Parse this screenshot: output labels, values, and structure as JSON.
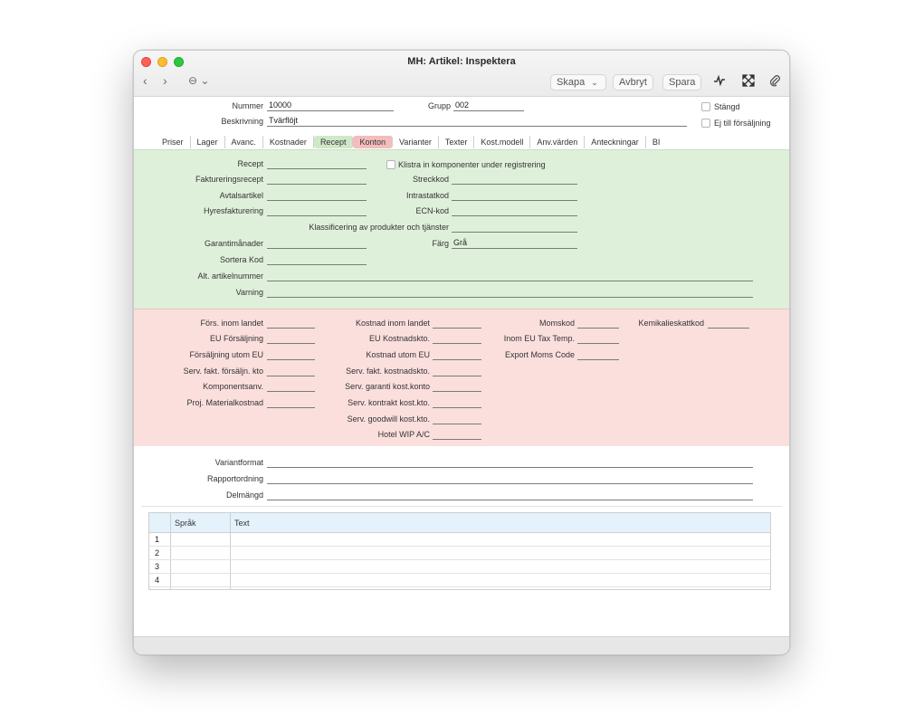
{
  "window": {
    "title": "MH: Artikel: Inspektera",
    "nav_back": "‹",
    "nav_forward": "›",
    "more_label": "⊖ ⌄"
  },
  "toolbar": {
    "create_label": "Skapa",
    "cancel_label": "Avbryt",
    "save_label": "Spara"
  },
  "header": {
    "number_label": "Nummer",
    "number_value": "10000",
    "group_label": "Grupp",
    "group_value": "002",
    "description_label": "Beskrivning",
    "description_value": "Tvärflöjt",
    "closed_label": "Stängd",
    "not_for_sale_label": "Ej till försäljning"
  },
  "tabs": [
    {
      "label": "Priser"
    },
    {
      "label": "Lager"
    },
    {
      "label": "Avanc."
    },
    {
      "label": "Kostnader"
    },
    {
      "label": "Recept"
    },
    {
      "label": "Konton"
    },
    {
      "label": "Varianter"
    },
    {
      "label": "Texter"
    },
    {
      "label": "Kost.modell"
    },
    {
      "label": "Anv.värden"
    },
    {
      "label": "Anteckningar"
    },
    {
      "label": "BI"
    }
  ],
  "recipe": {
    "recept": "Recept",
    "paste_label": "Klistra in komponenter under registrering",
    "invoice_recipe": "Faktureringsrecept",
    "barcode": "Streckkod",
    "contract_item": "Avtalsartikel",
    "intrastat": "Intrastatkod",
    "rental_invoicing": "Hyresfakturering",
    "ecn": "ECN-kod",
    "classification": "Klassificering av produkter och tjänster",
    "warranty_months": "Garantimånader",
    "color_label": "Färg",
    "color_value": "Grå",
    "sort_code": "Sortera Kod",
    "alt_item_no": "Alt. artikelnummer",
    "warning": "Varning"
  },
  "accounts": {
    "sales_domestic": "Förs. inom landet",
    "eu_sales": "EU Försäljning",
    "sales_outside_eu": "Försäljning utom EU",
    "serv_invoice_sales": "Serv. fakt. försäljn. kto",
    "component_use": "Komponentsanv.",
    "proj_material_cost": "Proj. Materialkostnad",
    "cost_domestic": "Kostnad inom landet",
    "eu_cost_acc": "EU Kostnadskto.",
    "cost_outside_eu": "Kostnad utom EU",
    "serv_invoice_cost": "Serv. fakt. kostnadskto.",
    "serv_warranty_cost": "Serv. garanti kost.konto",
    "serv_contract_cost": "Serv. kontrakt kost.kto.",
    "serv_goodwill_cost": "Serv. goodwill kost.kto.",
    "hotel_wip": "Hotel WIP A/C",
    "vat_code": "Momskod",
    "inom_eu_tax": "Inom EU Tax Temp.",
    "export_vat": "Export Moms Code",
    "chem_tax": "Kemikalieskattkod"
  },
  "bottom": {
    "variant_format": "Variantformat",
    "report_order": "Rapportordning",
    "sub_quantity": "Delmängd"
  },
  "grid": {
    "col_language": "Språk",
    "col_text": "Text",
    "rows": [
      "1",
      "2",
      "3",
      "4"
    ]
  },
  "colors": {
    "green_zone": "#dff0da",
    "red_zone": "#fbdfdd",
    "grid_header": "#e4f2fb"
  }
}
